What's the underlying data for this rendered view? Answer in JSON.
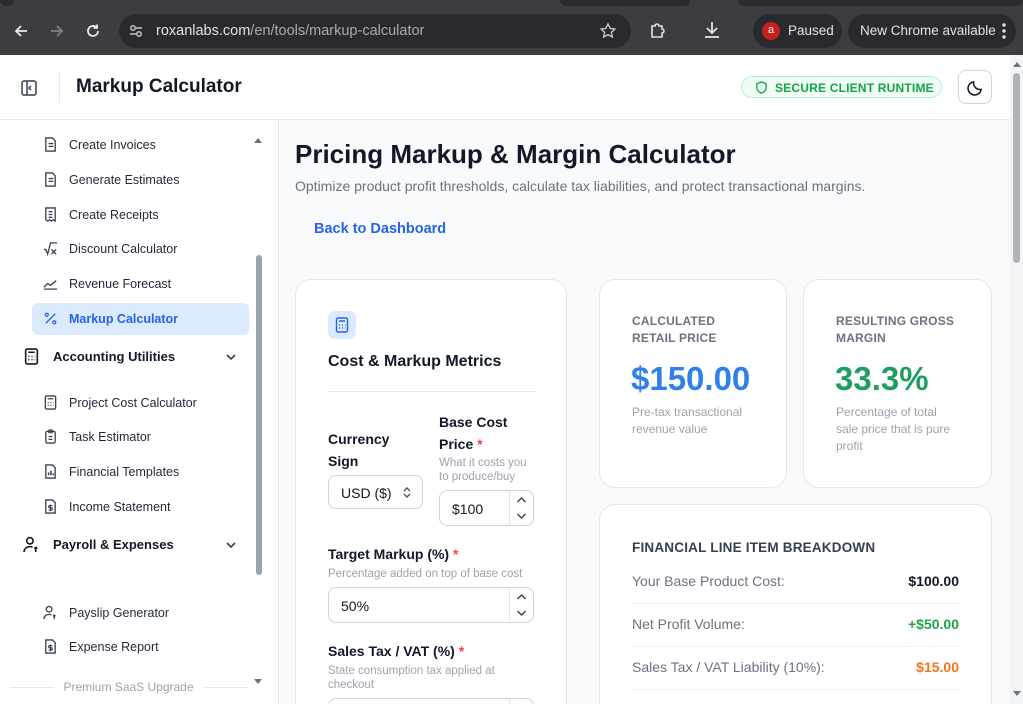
{
  "browser": {
    "url_host": "roxanlabs.com",
    "url_path": "/en/tools/markup-calculator",
    "profile_initial": "a",
    "profile_status": "Paused",
    "update_label": "New Chrome available"
  },
  "header": {
    "app_title": "Markup Calculator",
    "badge": "SECURE CLIENT RUNTIME"
  },
  "sidebar": {
    "items_top": [
      {
        "label": "Create Invoices",
        "icon": "document-icon"
      },
      {
        "label": "Generate Estimates",
        "icon": "document-icon"
      },
      {
        "label": "Create Receipts",
        "icon": "receipt-icon"
      },
      {
        "label": "Discount Calculator",
        "icon": "sqrt-icon"
      },
      {
        "label": "Revenue Forecast",
        "icon": "trend-icon"
      },
      {
        "label": "Markup Calculator",
        "icon": "percent-icon",
        "active": true
      }
    ],
    "group_accounting": "Accounting Utilities",
    "items_accounting": [
      {
        "label": "Project Cost Calculator",
        "icon": "calculator-icon"
      },
      {
        "label": "Task Estimator",
        "icon": "clipboard-icon"
      },
      {
        "label": "Financial Templates",
        "icon": "file-chart-icon"
      },
      {
        "label": "Income Statement",
        "icon": "file-dollar-icon"
      }
    ],
    "group_payroll": "Payroll & Expenses",
    "items_payroll": [
      {
        "label": "Payslip Generator",
        "icon": "user-money-icon"
      },
      {
        "label": "Expense Report",
        "icon": "file-dollar-icon"
      }
    ],
    "premium_label": "Premium SaaS Upgrade"
  },
  "page": {
    "title": "Pricing Markup & Margin Calculator",
    "subtitle": "Optimize product profit thresholds, calculate tax liabilities, and protect transactional margins.",
    "back_link": "Back to Dashboard"
  },
  "form": {
    "heading": "Cost & Markup Metrics",
    "currency_label": "Currency Sign",
    "currency_label_l1": "Currency",
    "currency_label_l2": "Sign",
    "currency_value": "USD ($)",
    "base_cost_label_l1": "Base Cost",
    "base_cost_label_l2": "Price",
    "base_cost_hint_l1": "What it costs you",
    "base_cost_hint_l2": "to produce/buy",
    "base_cost_value": "$100",
    "markup_label": "Target Markup (%)",
    "markup_hint": "Percentage added on top of base cost",
    "markup_value": "50%",
    "tax_label": "Sales Tax / VAT (%)",
    "tax_hint_l1": "State consumption tax applied at",
    "tax_hint_l2": "checkout",
    "required_mark": "*"
  },
  "stats": {
    "retail": {
      "caption_l1": "CALCULATED",
      "caption_l2": "RETAIL PRICE",
      "value": "$150.00",
      "desc_l1": "Pre-tax transactional",
      "desc_l2": "revenue value",
      "color": "#2f80ed"
    },
    "margin": {
      "caption_l1": "RESULTING GROSS",
      "caption_l2": "MARGIN",
      "value": "33.3%",
      "desc_l1": "Percentage of total",
      "desc_l2": "sale price that is pure",
      "desc_l3": "profit",
      "color": "#1f9d63"
    }
  },
  "breakdown": {
    "heading": "FINANCIAL LINE ITEM BREAKDOWN",
    "rows": [
      {
        "label": "Your Base Product Cost:",
        "value": "$100.00",
        "color": "#111827"
      },
      {
        "label": "Net Profit Volume:",
        "value": "+$50.00",
        "color": "#22a34a"
      },
      {
        "label": "Sales Tax / VAT Liability (10%):",
        "value": "$15.00",
        "color": "#f97316"
      }
    ]
  }
}
